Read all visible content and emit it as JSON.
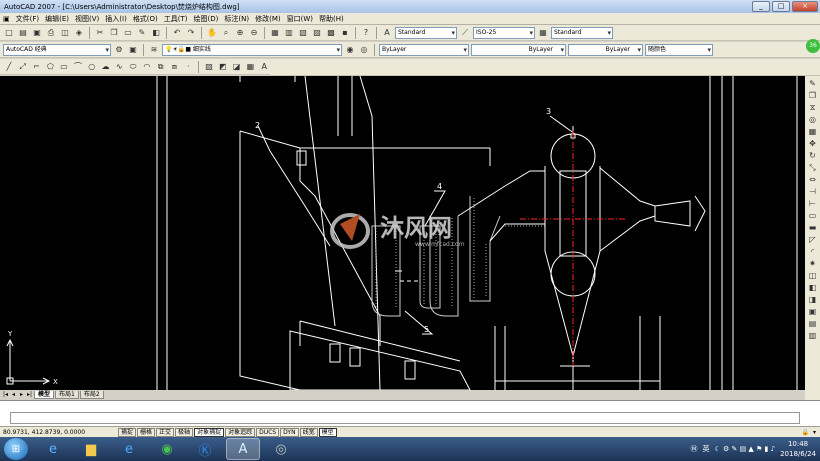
{
  "title": "AutoCAD 2007 - [C:\\Users\\Administrator\\Desktop\\焚烧炉结构图.dwg]",
  "window_buttons": [
    "_",
    "□",
    "×"
  ],
  "menu": [
    "文件(F)",
    "编辑(E)",
    "视图(V)",
    "插入(I)",
    "格式(O)",
    "工具(T)",
    "绘图(D)",
    "标注(N)",
    "修改(M)",
    "窗口(W)",
    "帮助(H)"
  ],
  "toolbar1": {
    "text_style": "Standard",
    "dim_style": "ISO-25",
    "table_style": "Standard"
  },
  "toolbar2": {
    "workspace": "AutoCAD 经典",
    "layer": "细实线",
    "color": "ByLayer",
    "linetype": "ByLayer",
    "lineweight": "ByLayer",
    "plotstyle": "随颜色"
  },
  "badge": "36",
  "drawing": {
    "callouts": [
      "2",
      "3",
      "4",
      "5"
    ],
    "watermark_cn": "沐风网",
    "watermark_url": "www.mfcad.com",
    "ucs_x": "X",
    "ucs_y": "Y"
  },
  "layout_tabs": [
    "模型",
    "布局1",
    "布局2"
  ],
  "status": {
    "coords": "80.9731, 412.8739, 0.0000",
    "buttons": [
      "捕捉",
      "栅格",
      "正交",
      "极轴",
      "对象捕捉",
      "对象追踪",
      "DUCS",
      "DYN",
      "线宽",
      "模型"
    ]
  },
  "taskbar": {
    "ime": "英",
    "time": "10:48",
    "date": "2018/6/24"
  }
}
